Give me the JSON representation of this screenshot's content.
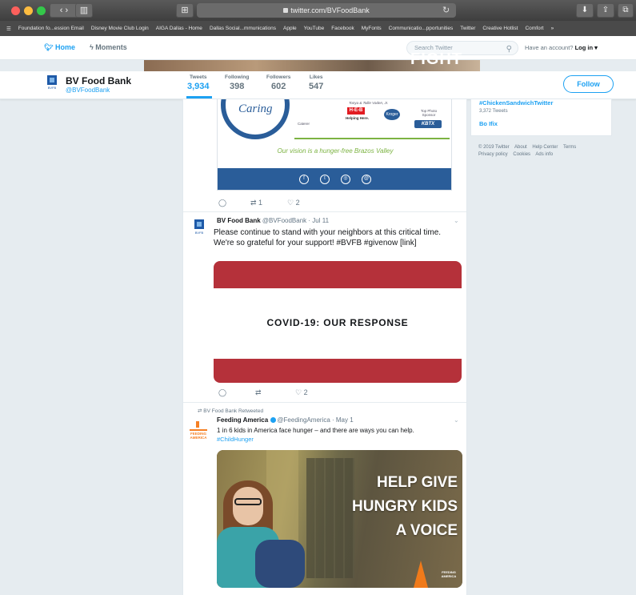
{
  "browser": {
    "url": "twitter.com/BVFoodBank",
    "bookmarks": [
      "Foundation fo...ession Email",
      "Disney Movie Club Login",
      "AIGA Dallas - Home",
      "Dallas Social...mmunications",
      "Apple",
      "YouTube",
      "Facebook",
      "MyFonts",
      "Communicatio...pportunities",
      "Twitter",
      "Creative Hotlist",
      "Comfort"
    ]
  },
  "twitter_nav": {
    "home": "Home",
    "moments": "Moments",
    "search_placeholder": "Search Twitter",
    "login_prompt": "Have an account?",
    "login_link": "Log in",
    "banner_text": "FIGHT"
  },
  "profile": {
    "name": "BV Food Bank",
    "handle": "@BVFoodBank",
    "logo_text": "BVFB",
    "follow_label": "Follow",
    "stats": [
      {
        "label": "Tweets",
        "value": "3,934"
      },
      {
        "label": "Following",
        "value": "398"
      },
      {
        "label": "Followers",
        "value": "602"
      },
      {
        "label": "Likes",
        "value": "547"
      }
    ]
  },
  "tweet1": {
    "card": {
      "caring": "Caring",
      "sponsor1": "Tonya & Tollie Vaden, Jr.",
      "sponsor2": "Top Photo Sponsor",
      "sponsor_heb": "H-E-B",
      "sponsor_heb_sub": "Helping Here.",
      "sponsor_kroger": "Kroger",
      "sponsor_kbtx": "KBTX",
      "caterer": "Caterer",
      "vision": "Our vision is a hunger-free Brazos Valley"
    },
    "retweets": "1",
    "likes": "2"
  },
  "tweet2": {
    "name": "BV Food Bank",
    "handle": "@BVFoodBank",
    "date": "Jul 11",
    "text_line1": "Please continue to stand with your neighbors at this critical time.",
    "text_line2": "We're so grateful for your support! #BVFB #givenow [link]",
    "image_headline": "COVID-19: OUR RESPONSE",
    "likes": "2"
  },
  "tweet3": {
    "retweeted_by": "BV Food Bank Retweeted",
    "name": "Feeding America",
    "handle": "@FeedingAmerica",
    "date": "May 1",
    "text": "1 in 6 kids in America face hunger – and there are ways you can help.",
    "hashtag": "#ChildHunger",
    "logo_text": "FEEDING AMERICA",
    "image_lines": [
      "HELP GIVE",
      "HUNGRY KIDS",
      "A VOICE"
    ]
  },
  "sidebar": {
    "trend1": "#ChickenSandwichTwitter",
    "trend1_count": "3,372 Tweets",
    "trend2": "Bo Ifix",
    "footer": [
      "© 2019 Twitter",
      "About",
      "Help Center",
      "Terms",
      "Privacy policy",
      "Cookies",
      "Ads info"
    ]
  }
}
